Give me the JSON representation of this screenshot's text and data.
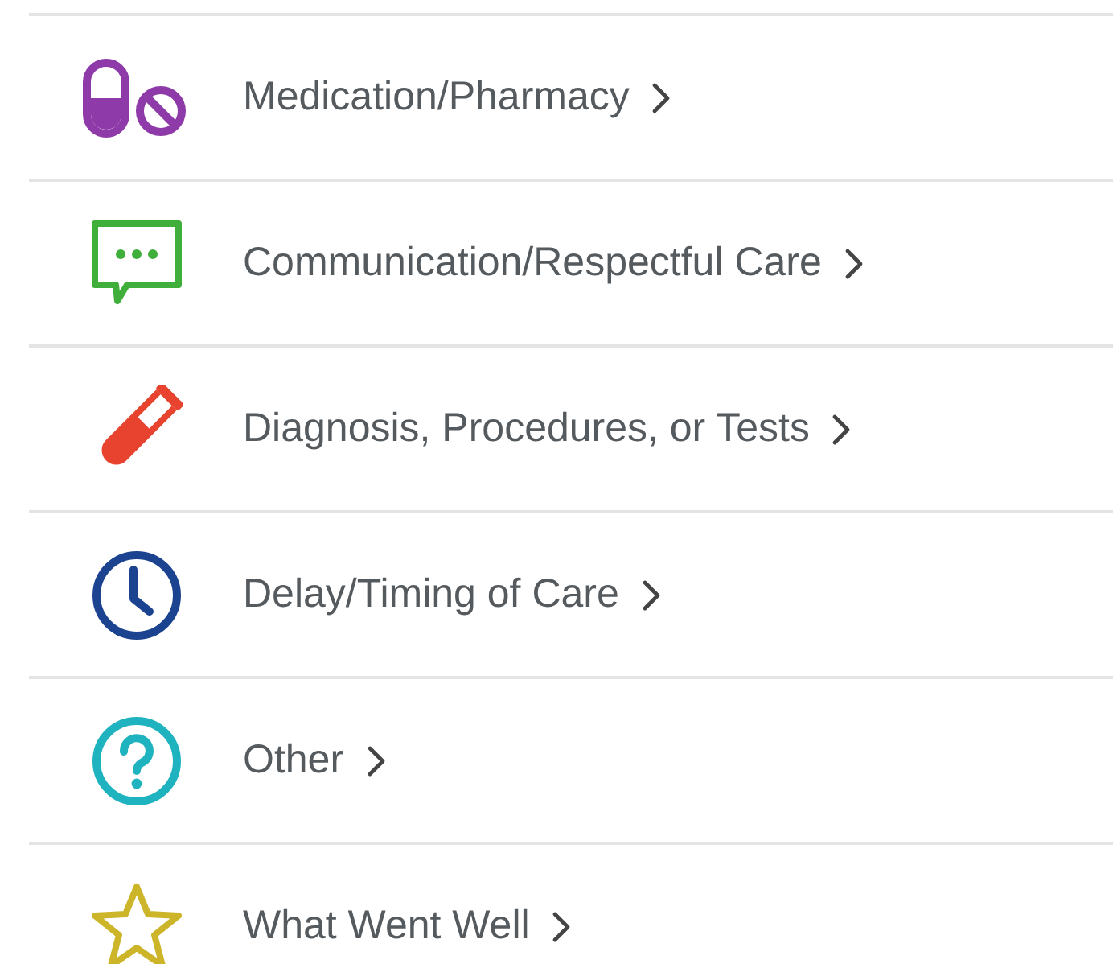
{
  "categories": [
    {
      "label": "Medication/Pharmacy",
      "kind": "pill",
      "color": "#8e3aa8"
    },
    {
      "label": "Communication/Respectful Care",
      "kind": "chat",
      "color": "#3fae3a"
    },
    {
      "label": "Diagnosis, Procedures, or Tests",
      "kind": "tube",
      "color": "#e8432f"
    },
    {
      "label": "Delay/Timing of Care",
      "kind": "clock",
      "color": "#1c4390"
    },
    {
      "label": "Other",
      "kind": "question",
      "color": "#1fb3c0"
    },
    {
      "label": "What Went Well",
      "kind": "star",
      "color": "#cdb52a"
    }
  ]
}
